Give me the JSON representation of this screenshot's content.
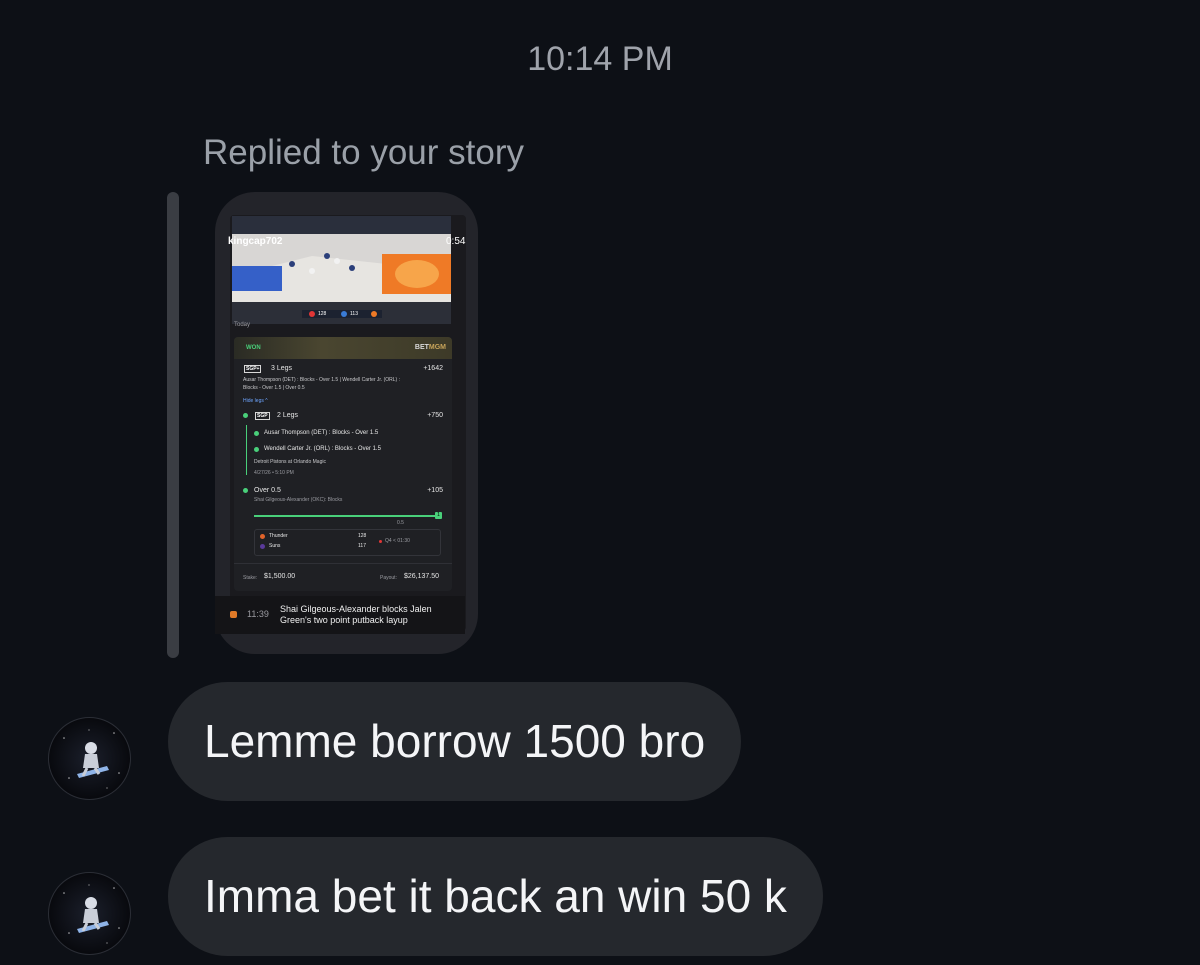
{
  "header": {
    "timestamp": "10:14 PM"
  },
  "story_reply": {
    "label": "Replied to your story",
    "story": {
      "username": "kingcap702",
      "duration": "0:54",
      "posted": "Today",
      "scoreboard": {
        "home_score": "128",
        "away_score": "113"
      },
      "bet_card": {
        "status": "WON",
        "brand": {
          "prefix": "BET",
          "suffix": "MGM"
        },
        "parlay": {
          "badge": "SGP+",
          "title": "3 Legs",
          "odds": "+1642",
          "summary_line1": "Ausar Thompson (DET) : Blocks - Over 1.5 | Wendell Carter Jr. (ORL) :",
          "summary_line2": "Blocks - Over 1.5 | Over 0.5",
          "toggle": "Hide legs ^"
        },
        "sgp": {
          "badge": "SGP",
          "title": "2 Legs",
          "odds": "+750",
          "leg1": "Ausar Thompson (DET) : Blocks - Over 1.5",
          "leg2": "Wendell Carter Jr. (ORL) : Blocks - Over 1.5",
          "game": "Detroit Pistons at Orlando Magic",
          "date": "4/27/26 • 5:10 PM"
        },
        "leg3": {
          "title": "Over 0.5",
          "odds": "+105",
          "player": "Shai Gilgeous-Alexander (OKC): Blocks",
          "progress_marker": "0.5",
          "progress_value": "1",
          "progress": 1.0
        },
        "game": {
          "team1": "Thunder",
          "score1": "128",
          "team2": "Suns",
          "score2": "117",
          "clock": "Q4 < 01:30"
        },
        "stake_label": "Stake:",
        "stake": "$1,500.00",
        "payout_label": "Payout:",
        "payout": "$26,137.50"
      },
      "footer": {
        "time": "11:39",
        "text": "Shai Gilgeous-Alexander blocks Jalen Green's two point putback layup"
      }
    }
  },
  "messages": [
    {
      "text": "Lemme borrow 1500 bro"
    },
    {
      "text": "Imma bet it back an win 50 k"
    }
  ],
  "colors": {
    "background": "#0d1016",
    "bubble": "#25282d",
    "won_green": "#49d07a",
    "mgm_gold": "#c8a45a"
  }
}
